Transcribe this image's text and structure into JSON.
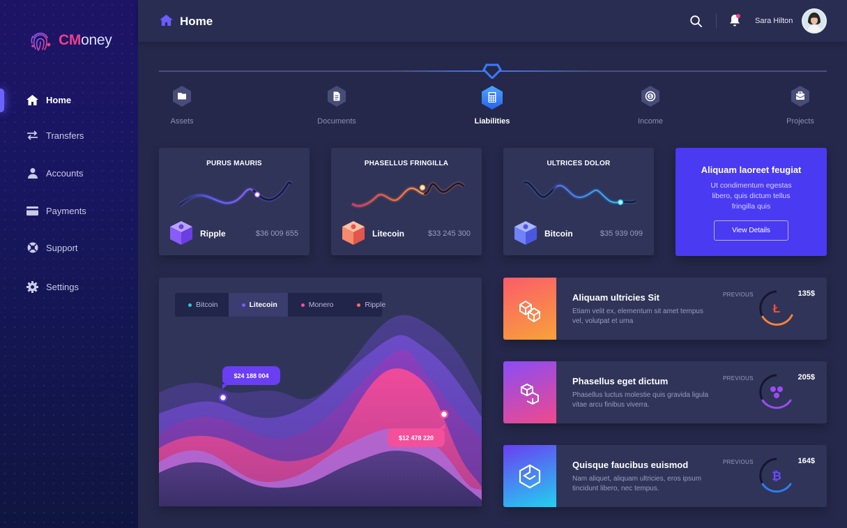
{
  "brand": {
    "logo_bold": "CM",
    "logo_rest": "oney"
  },
  "nav": {
    "items": [
      {
        "label": "Home"
      },
      {
        "label": "Transfers"
      },
      {
        "label": "Accounts"
      },
      {
        "label": "Payments"
      },
      {
        "label": "Support"
      },
      {
        "label": "Settings"
      }
    ],
    "active": "Home"
  },
  "header": {
    "title": "Home",
    "user": "Sara Hilton"
  },
  "steps": [
    {
      "label": "Assets"
    },
    {
      "label": "Documents"
    },
    {
      "label": "Liabilities"
    },
    {
      "label": "Income"
    },
    {
      "label": "Projects"
    }
  ],
  "active_step": "Liabilities",
  "cards": [
    {
      "title": "PURUS MAURIS",
      "coin": "Ripple",
      "value": "$36 009 655",
      "color": "#8f5cf6"
    },
    {
      "title": "PHASELLUS FRINGILLA",
      "coin": "Litecoin",
      "value": "$33 245 300",
      "color": "#f5835c"
    },
    {
      "title": "ULTRICES DOLOR",
      "coin": "Bitcoin",
      "value": "$35 939 099",
      "color": "#5a6ff5"
    }
  ],
  "promo": {
    "title": "Aliquam laoreet feugiat",
    "text": "Ut condimentum egestas libero, quis dictum tellus fringilla quis",
    "button": "View Details"
  },
  "chart": {
    "legend": [
      {
        "label": "Bitcoin",
        "color": "#2ec7d8"
      },
      {
        "label": "Litecoin",
        "color": "#7c5cff"
      },
      {
        "label": "Monero",
        "color": "#f2509b"
      },
      {
        "label": "Ripple",
        "color": "#f5705a"
      }
    ],
    "active": "Litecoin",
    "tooltips": [
      "$24 188 004",
      "$12 478 220"
    ]
  },
  "rows": [
    {
      "title": "Aliquam ultricies Sit",
      "desc": "Etiam velit ex, elementum sit amet tempus vel, volutpat et urna",
      "previous": "PREVIOUS",
      "amount": "135$",
      "icon": "litecoin-icon"
    },
    {
      "title": "Phasellus eget dictum",
      "desc": "Phasellus luctus molestie quis gravida ligula vitae arcu finibus viverra.",
      "previous": "PREVIOUS",
      "amount": "205$",
      "icon": "ripple-icon"
    },
    {
      "title": "Quisque faucibus euismod",
      "desc": "Nam aliquet, aliquam ultricies, eros ipsum tincidunt libero, nec tempus.",
      "previous": "PREVIOUS",
      "amount": "164$",
      "icon": "bitcoin-icon"
    }
  ],
  "colors": {
    "accent": "#4a3af2",
    "pink": "#ee3f8a",
    "panel": "#303459",
    "background": "#25284a"
  }
}
